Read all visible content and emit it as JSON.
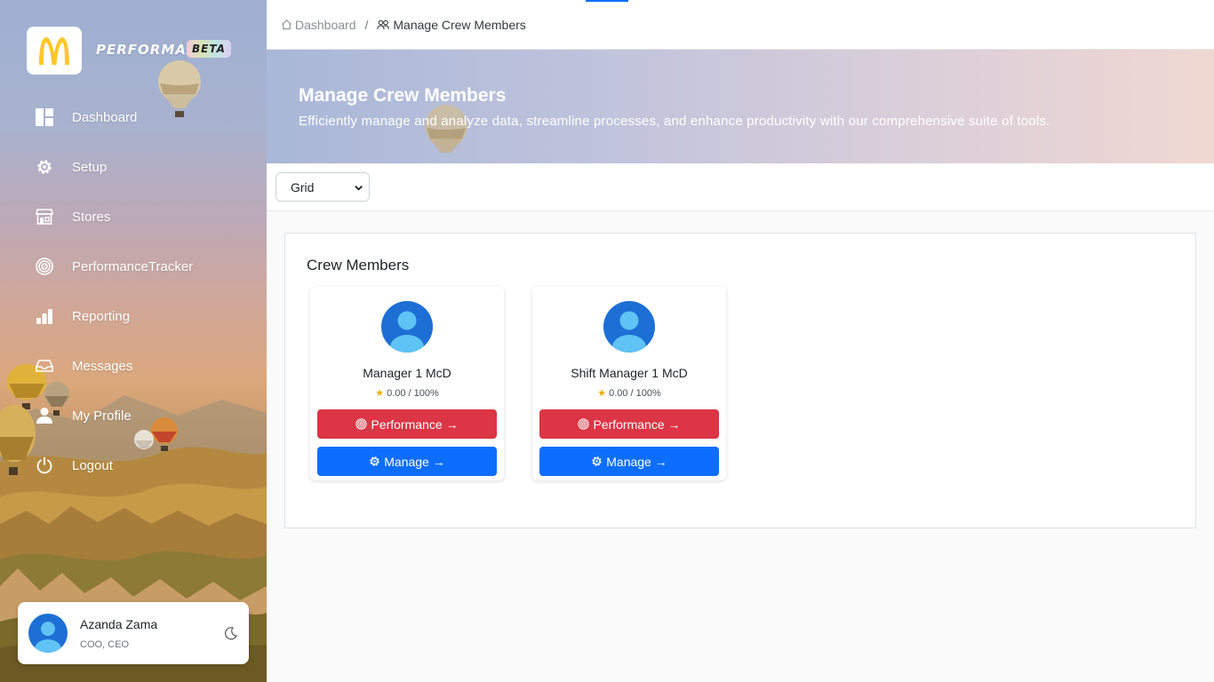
{
  "brand": {
    "name": "PERFORMAX",
    "badge": "BETA"
  },
  "sidebar": {
    "items": [
      {
        "label": "Dashboard",
        "icon": "dashboard-icon"
      },
      {
        "label": "Setup",
        "icon": "gear-icon"
      },
      {
        "label": "Stores",
        "icon": "store-icon"
      },
      {
        "label": "PerformanceTracker",
        "icon": "target-icon"
      },
      {
        "label": "Reporting",
        "icon": "bar-chart-icon"
      },
      {
        "label": "Messages",
        "icon": "inbox-icon"
      },
      {
        "label": "My Profile",
        "icon": "person-icon"
      },
      {
        "label": "Logout",
        "icon": "power-icon"
      }
    ]
  },
  "user": {
    "name": "Azanda Zama",
    "role": "COO, CEO",
    "theme_toggle_icon": "moon-icon"
  },
  "breadcrumb": {
    "home": "Dashboard",
    "current": "Manage Crew Members"
  },
  "banner": {
    "title": "Manage Crew Members",
    "subtitle": "Efficiently manage and analyze data, streamline processes, and enhance productivity with our comprehensive suite of tools."
  },
  "view_select": {
    "value": "Grid"
  },
  "crew": {
    "heading": "Crew Members",
    "members": [
      {
        "name": "Manager 1 McD",
        "rating": "0.00 / 100%",
        "performance_label": "Performance →",
        "manage_label": "Manage →"
      },
      {
        "name": "Shift Manager 1 McD",
        "rating": "0.00 / 100%",
        "performance_label": "Performance →",
        "manage_label": "Manage →"
      }
    ]
  },
  "colors": {
    "primary": "#0d6efd",
    "danger": "#dc3545",
    "brand_gold": "#ffc72c"
  }
}
